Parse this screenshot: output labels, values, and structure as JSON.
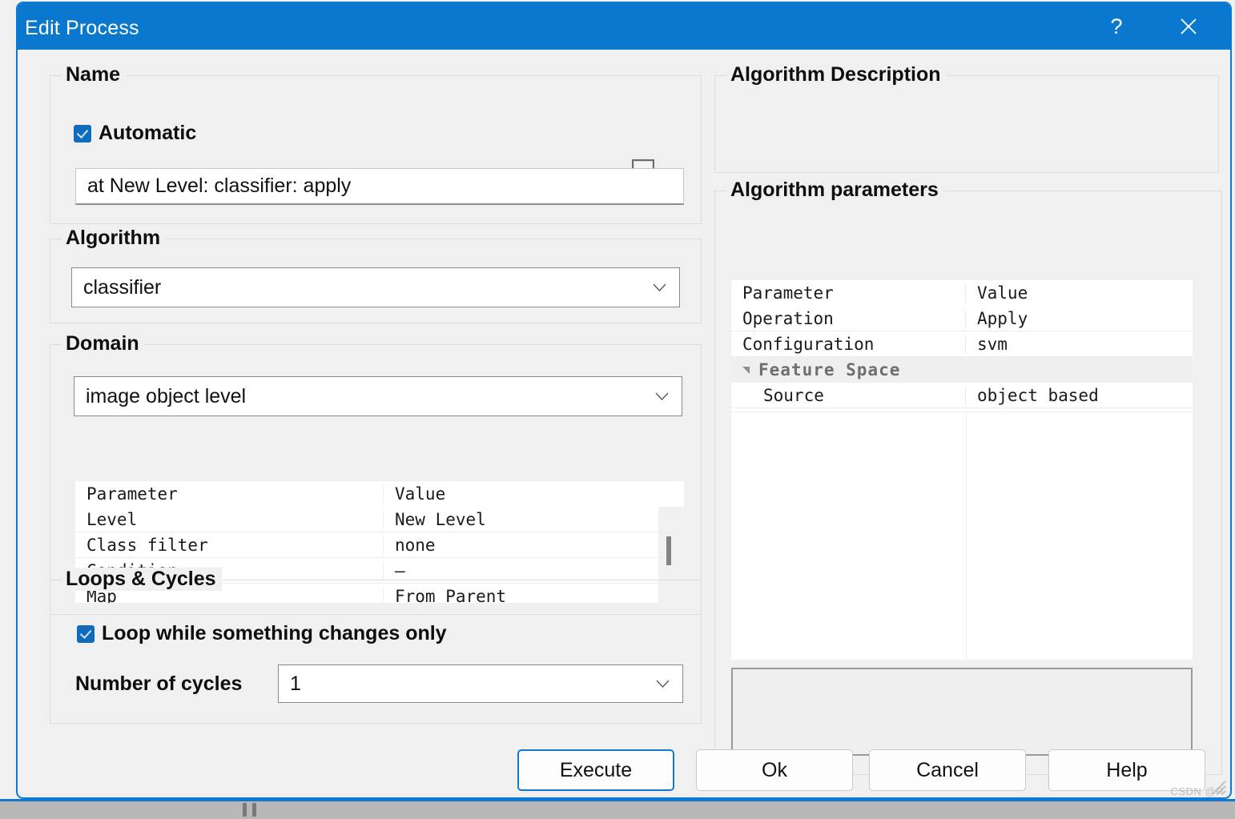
{
  "window": {
    "title": "Edit Process",
    "help_glyph": "?",
    "close_glyph": "✕"
  },
  "name_group": {
    "title": "Name",
    "automatic_label": "Automatic",
    "automatic_checked": true,
    "process_name": "at  New Level: classifier: apply",
    "edit_icon": "document-edit-icon"
  },
  "algorithm_group": {
    "title": "Algorithm",
    "selected": "classifier"
  },
  "domain_group": {
    "title": "Domain",
    "selected": "image object level",
    "table": {
      "headers": [
        "Parameter",
        "Value"
      ],
      "rows": [
        {
          "parameter": "Level",
          "value": "New Level"
        },
        {
          "parameter": "Class filter",
          "value": "none"
        },
        {
          "parameter": "Condition",
          "value": "—"
        },
        {
          "parameter": "Map",
          "value": "From Parent"
        }
      ]
    }
  },
  "loops_group": {
    "title": "Loops & Cycles",
    "loop_label": "Loop while something changes only",
    "loop_checked": true,
    "cycles_label": "Number of cycles",
    "cycles_value": "1"
  },
  "algorithm_description": {
    "title": "Algorithm Description",
    "text": ""
  },
  "algorithm_parameters": {
    "title": "Algorithm parameters",
    "headers": [
      "Parameter",
      "Value"
    ],
    "rows": [
      {
        "parameter": "Operation",
        "value": "Apply",
        "group": false,
        "indent": false
      },
      {
        "parameter": "Configuration",
        "value": "svm",
        "group": false,
        "indent": false
      },
      {
        "parameter": "Feature Space",
        "value": "",
        "group": true,
        "indent": false
      },
      {
        "parameter": "Source",
        "value": "object based",
        "group": false,
        "indent": true
      }
    ],
    "hint_text": ""
  },
  "buttons": {
    "execute": "Execute",
    "ok": "Ok",
    "cancel": "Cancel",
    "help": "Help"
  },
  "watermark": "CSDN @R",
  "colors": {
    "titlebar": "#0a78ce",
    "accent": "#0f78d0",
    "dialog_bg": "#f0f0f0",
    "checkbox": "#0f6cbd"
  }
}
